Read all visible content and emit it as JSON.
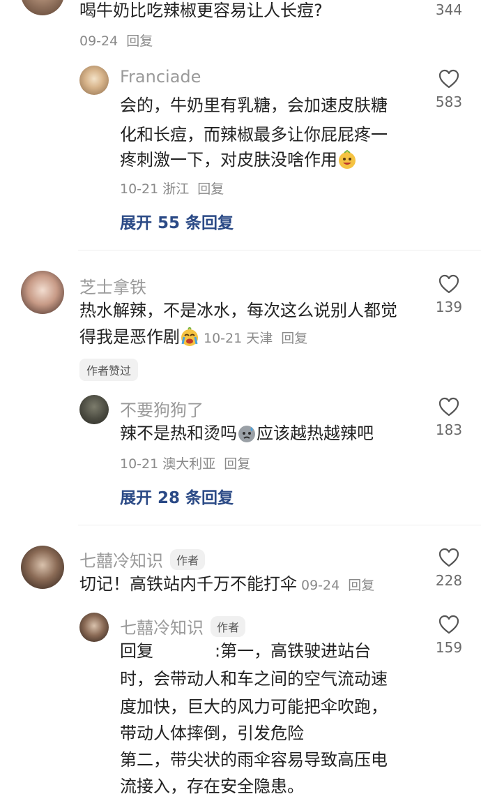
{
  "c0": {
    "text": "喝牛奶比吃辣椒更容易让人长痘?",
    "date": "09-24",
    "reply": "回复",
    "likes": "344"
  },
  "c0r1": {
    "name": "Franciade",
    "lines": [
      "会的，牛奶里有乳糖，会加速皮肤糖",
      "化和长痘，而辣椒最多让你屁屁疼一",
      "疼刺激一下，对皮肤没啥作用"
    ],
    "date": "10-21",
    "location": "浙江",
    "reply": "回复",
    "likes": "583"
  },
  "c0_expand": "展开 55 条回复",
  "c1": {
    "name": "芝士拿铁",
    "lines": [
      "热水解辣，不是冰水，每次这么说别人都觉",
      "得我是恶作剧"
    ],
    "date": "10-21",
    "location": "天津",
    "reply": "回复",
    "likes": "139",
    "badge": "作者赞过"
  },
  "c1r1": {
    "name": "不要狗狗了",
    "line_a": "辣不是热和烫吗",
    "line_b": "应该越热越辣吧",
    "date": "10-21",
    "location": "澳大利亚",
    "reply": "回复",
    "likes": "183"
  },
  "c1_expand": "展开 28 条回复",
  "c2": {
    "name": "七囍冷知识",
    "author": "作者",
    "text": "切记！高铁站内千万不能打伞",
    "date": "09-24",
    "reply": "回复",
    "likes": "228"
  },
  "c2r1": {
    "name": "七囍冷知识",
    "author": "作者",
    "reply_prefix": "回复",
    "lines": [
      ":第一，高铁驶进站台",
      "时，会带动人和车之间的空气流动速",
      "度加快，巨大的风力可能把伞吹跑，",
      "带动人体摔倒，引发危险",
      "第二，带尖状的雨伞容易导致高压电",
      "流接入，存在安全隐患。"
    ],
    "likes": "159"
  },
  "icons": {
    "like": "heart-outline-icon",
    "emoji_smile": "grin-emoji-icon",
    "emoji_cry": "crying-emoji-icon",
    "emoji_sweat": "sweat-emoji-icon"
  }
}
